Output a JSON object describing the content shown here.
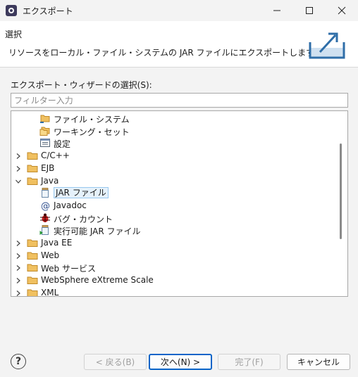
{
  "window": {
    "title": "エクスポート"
  },
  "header": {
    "title": "選択",
    "description": "リソースをローカル・ファイル・システムの JAR ファイルにエクスポートします。"
  },
  "wizard": {
    "label": "エクスポート・ウィザードの選択(S):",
    "filter_placeholder": "フィルター入力",
    "filter_value": ""
  },
  "tree": {
    "items": [
      {
        "label": "ファイル・システム",
        "icon": "folder-export-icon",
        "level": 2,
        "expander": "none"
      },
      {
        "label": "ワーキング・セット",
        "icon": "working-set-icon",
        "level": 2,
        "expander": "none"
      },
      {
        "label": "設定",
        "icon": "preferences-icon",
        "level": 2,
        "expander": "none"
      },
      {
        "label": "C/C++",
        "icon": "folder-icon",
        "level": 1,
        "expander": "collapsed"
      },
      {
        "label": "EJB",
        "icon": "folder-icon",
        "level": 1,
        "expander": "collapsed"
      },
      {
        "label": "Java",
        "icon": "folder-icon",
        "level": 1,
        "expander": "expanded"
      },
      {
        "label": "JAR ファイル",
        "icon": "jar-icon",
        "level": 2,
        "expander": "none",
        "selected": true
      },
      {
        "label": "Javadoc",
        "icon": "javadoc-icon",
        "level": 2,
        "expander": "none"
      },
      {
        "label": "バグ・カウント",
        "icon": "bug-icon",
        "level": 2,
        "expander": "none"
      },
      {
        "label": "実行可能 JAR ファイル",
        "icon": "runnable-jar-icon",
        "level": 2,
        "expander": "none"
      },
      {
        "label": "Java EE",
        "icon": "folder-icon",
        "level": 1,
        "expander": "collapsed"
      },
      {
        "label": "Web",
        "icon": "folder-icon",
        "level": 1,
        "expander": "collapsed"
      },
      {
        "label": "Web サービス",
        "icon": "folder-icon",
        "level": 1,
        "expander": "collapsed"
      },
      {
        "label": "WebSphere eXtreme Scale",
        "icon": "folder-icon",
        "level": 1,
        "expander": "collapsed"
      },
      {
        "label": "XML",
        "icon": "folder-icon",
        "level": 1,
        "expander": "collapsed"
      }
    ]
  },
  "buttons": {
    "back": "< 戻る(B)",
    "next": "次へ(N) >",
    "finish": "完了(F)",
    "cancel": "キャンセル",
    "help": "?"
  },
  "colors": {
    "selection_bg": "#e5f1fb",
    "selection_border": "#99c9ef",
    "default_button_border": "#0a64c8",
    "folder": "#e8b04a"
  }
}
